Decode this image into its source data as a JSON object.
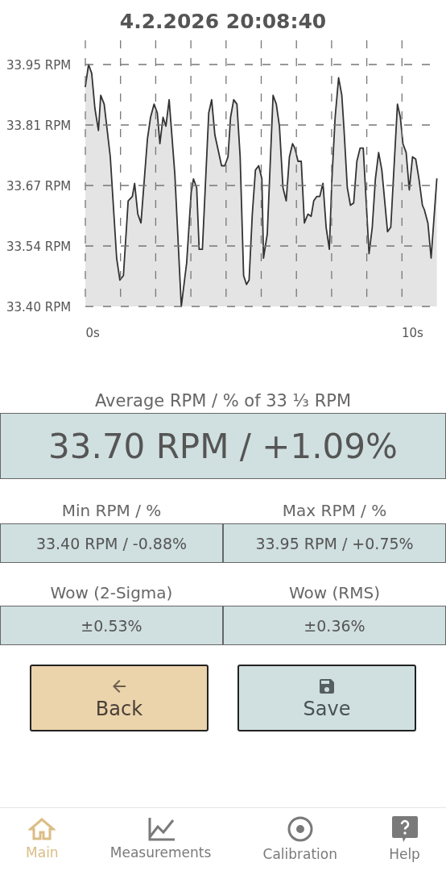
{
  "title": "4.2.2026 20:08:40",
  "chart": {
    "chart_data": {
      "type": "line",
      "grid": true,
      "xlim": [
        -0.23,
        10.77
      ],
      "ylim": [
        33.4,
        33.95
      ],
      "xticks": [
        {
          "value": 0,
          "label": "0s"
        },
        {
          "value": 10,
          "label": "10s"
        }
      ],
      "yticks": [
        {
          "value": 33.4,
          "label": "33.40 RPM"
        },
        {
          "value": 33.5375,
          "label": "33.54 RPM"
        },
        {
          "value": 33.675,
          "label": "33.67 RPM"
        },
        {
          "value": 33.8125,
          "label": "33.81 RPM"
        },
        {
          "value": 33.95,
          "label": "33.95 RPM"
        }
      ],
      "x": [
        -0.23,
        -0.13,
        -0.03,
        0.07,
        0.18,
        0.25,
        0.36,
        0.55,
        0.75,
        0.85,
        0.96,
        1.11,
        1.24,
        1.31,
        1.41,
        1.51,
        1.71,
        1.81,
        1.92,
        2.02,
        2.1,
        2.2,
        2.29,
        2.39,
        2.57,
        2.77,
        2.94,
        3.08,
        3.15,
        3.25,
        3.33,
        3.43,
        3.63,
        3.72,
        3.82,
        4.03,
        4.13,
        4.23,
        4.31,
        4.41,
        4.51,
        4.61,
        4.72,
        4.81,
        4.89,
        4.99,
        5.09,
        5.19,
        5.29,
        5.34,
        5.46,
        5.64,
        5.74,
        5.84,
        5.95,
        6.05,
        6.15,
        6.25,
        6.32,
        6.42,
        6.52,
        6.62,
        6.73,
        6.83,
        6.91,
        7.01,
        7.1,
        7.2,
        7.3,
        7.4,
        7.48,
        7.58,
        7.69,
        7.79,
        7.86,
        7.96,
        8.06,
        8.16,
        8.26,
        8.36,
        8.46,
        8.64,
        8.74,
        8.84,
        8.94,
        9.04,
        9.22,
        9.32,
        9.53,
        9.62,
        9.7,
        9.8,
        9.9,
        10.0,
        10.1,
        10.2,
        10.31,
        10.37,
        10.48,
        10.58,
        10.76
      ],
      "series": [
        {
          "color": "#333333",
          "values": [
            33.9,
            33.95,
            33.93,
            33.85,
            33.8,
            33.88,
            33.86,
            33.74,
            33.51,
            33.46,
            33.47,
            33.64,
            33.65,
            33.68,
            33.61,
            33.59,
            33.78,
            33.83,
            33.86,
            33.84,
            33.77,
            33.83,
            33.81,
            33.87,
            33.7,
            33.4,
            33.5,
            33.66,
            33.69,
            33.67,
            33.53,
            33.53,
            33.84,
            33.87,
            33.79,
            33.72,
            33.72,
            33.74,
            33.83,
            33.87,
            33.86,
            33.74,
            33.47,
            33.45,
            33.46,
            33.61,
            33.71,
            33.72,
            33.69,
            33.51,
            33.565,
            33.88,
            33.86,
            33.81,
            33.67,
            33.64,
            33.74,
            33.77,
            33.76,
            33.73,
            33.73,
            33.59,
            33.61,
            33.605,
            33.64,
            33.65,
            33.65,
            33.68,
            33.58,
            33.53,
            33.69,
            33.83,
            33.92,
            33.88,
            33.8,
            33.67,
            33.63,
            33.635,
            33.73,
            33.76,
            33.76,
            33.52,
            33.58,
            33.69,
            33.75,
            33.71,
            33.57,
            33.58,
            33.86,
            33.83,
            33.77,
            33.75,
            33.665,
            33.74,
            33.735,
            33.69,
            33.63,
            33.62,
            33.59,
            33.51,
            33.69
          ]
        }
      ]
    }
  },
  "average": {
    "label": "Average RPM / % of 33 ⅓ RPM",
    "value": "33.70 RPM / +1.09%"
  },
  "stats": [
    {
      "label": "Min RPM / %",
      "value": "33.40 RPM / -0.88%"
    },
    {
      "label": "Max RPM / %",
      "value": "33.95 RPM / +0.75%"
    },
    {
      "label": "Wow (2-Sigma)",
      "value": "±0.53%"
    },
    {
      "label": "Wow (RMS)",
      "value": "±0.36%"
    }
  ],
  "buttons": [
    {
      "kind": "back",
      "label": "Back"
    },
    {
      "kind": "save",
      "label": "Save"
    }
  ],
  "nav": [
    {
      "kind": "home",
      "label": "Main",
      "selected": true
    },
    {
      "kind": "chart",
      "label": "Measurements",
      "selected": false
    },
    {
      "kind": "target",
      "label": "Calibration",
      "selected": false
    },
    {
      "kind": "help",
      "label": "Help",
      "selected": false
    }
  ]
}
